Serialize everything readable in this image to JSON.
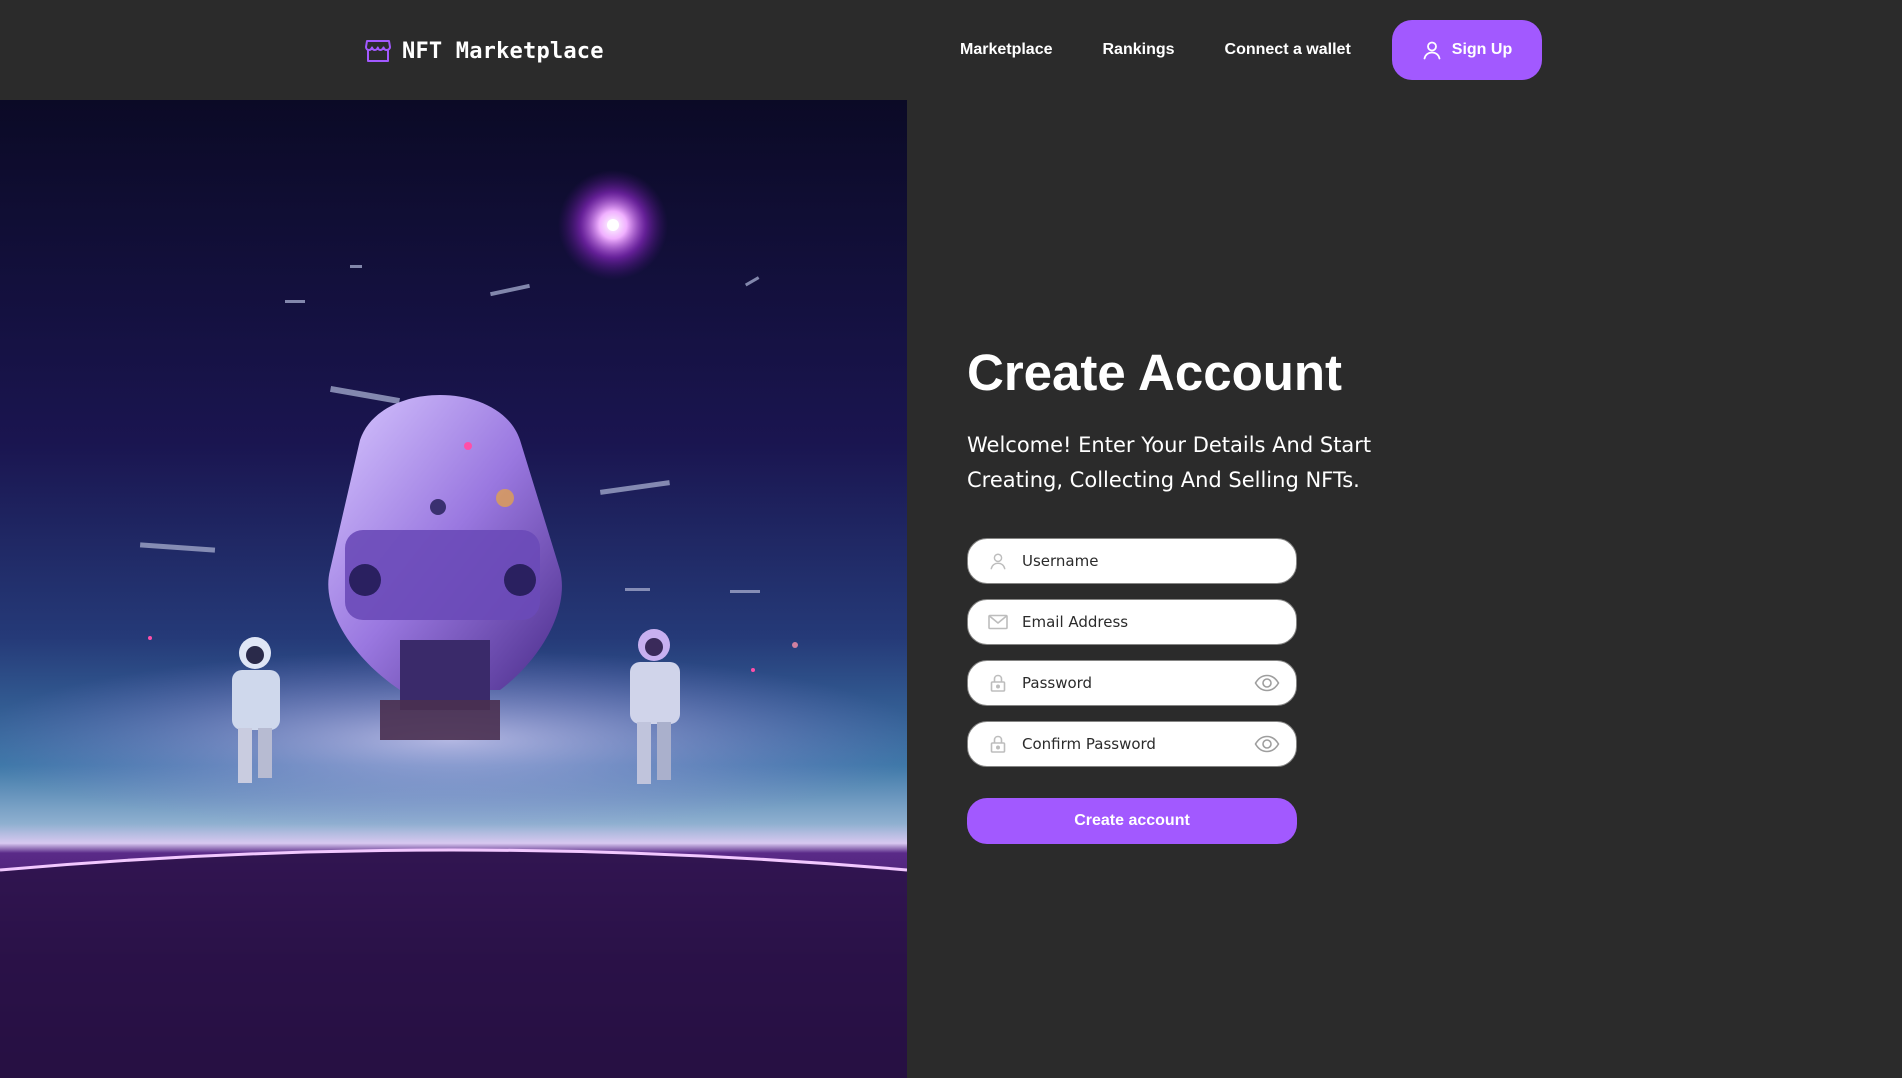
{
  "brand": {
    "name": "NFT Marketplace",
    "icon": "storefront-icon"
  },
  "nav": {
    "links": [
      "Marketplace",
      "Rankings",
      "Connect a wallet"
    ],
    "signup_label": "Sign Up",
    "signup_icon": "user-icon"
  },
  "colors": {
    "accent": "#a259ff",
    "background": "#2b2b2b",
    "text": "#ffffff",
    "field_border": "#858584"
  },
  "hero": {
    "image": "astronauts-spaceship-planet-illustration"
  },
  "form": {
    "title": "Create Account",
    "subtitle": "Welcome! Enter Your Details And Start Creating, Collecting And Selling NFTs.",
    "fields": [
      {
        "placeholder": "Username",
        "icon": "user-icon",
        "type": "text"
      },
      {
        "placeholder": "Email Address",
        "icon": "envelope-icon",
        "type": "email"
      },
      {
        "placeholder": "Password",
        "icon": "lock-icon",
        "type": "password",
        "toggle_icon": "eye-icon"
      },
      {
        "placeholder": "Confirm Password",
        "icon": "lock-icon",
        "type": "password",
        "toggle_icon": "eye-icon"
      }
    ],
    "submit_label": "Create account"
  }
}
